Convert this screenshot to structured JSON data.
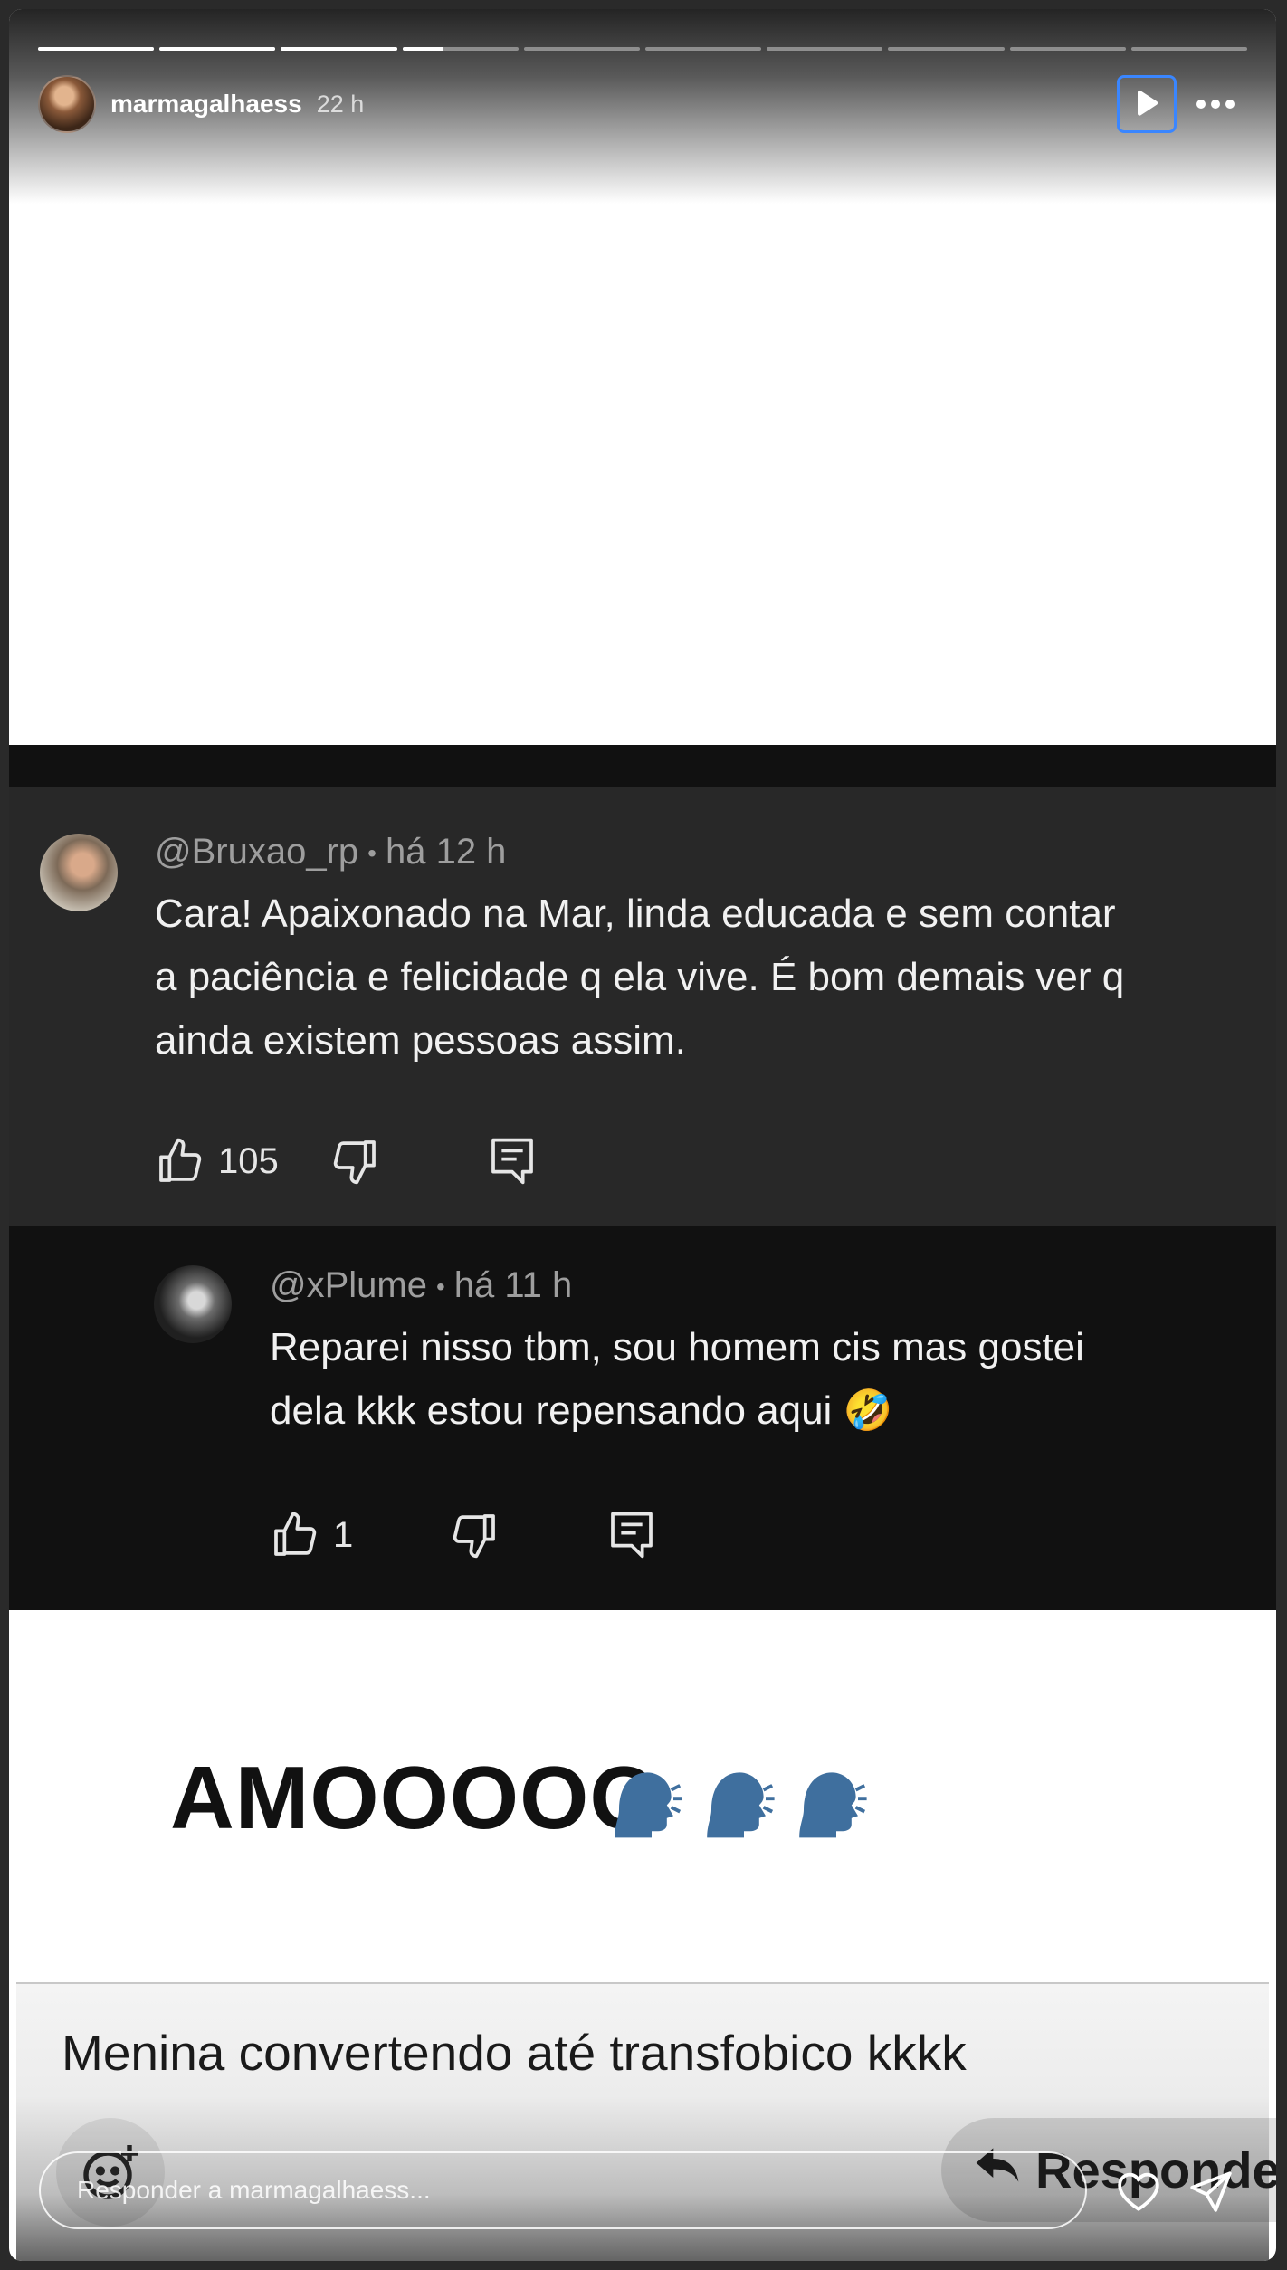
{
  "story": {
    "username": "marmagalhaess",
    "time": "22 h",
    "progress": {
      "segments": 10,
      "completed": 3,
      "current_fraction": 0.35
    }
  },
  "comments": [
    {
      "handle": "@Bruxao_rp",
      "time": "há 12 h",
      "lines": [
        "Cara! Apaixonado na Mar, linda educada e sem contar",
        "a paciência e felicidade q ela vive. É bom demais ver q",
        "ainda existem pessoas assim."
      ],
      "likes": "105"
    },
    {
      "handle": "@xPlume",
      "time": "há 11 h",
      "lines": [
        "Reparei nisso tbm, sou homem cis mas gostei",
        "dela kkk estou repensando aqui 🤣"
      ],
      "likes": "1"
    }
  ],
  "meme_text": "AMOOOOO",
  "meme_emoji": "🗣",
  "caption": "Menina convertendo até transfobico kkkk",
  "ghost_reply_label": "Responder",
  "reply_placeholder": "Responder a marmagalhaess...",
  "colors": {
    "accent_focus": "#3a86ff",
    "comment_bg": "#282828",
    "reply_bg": "#111111"
  }
}
